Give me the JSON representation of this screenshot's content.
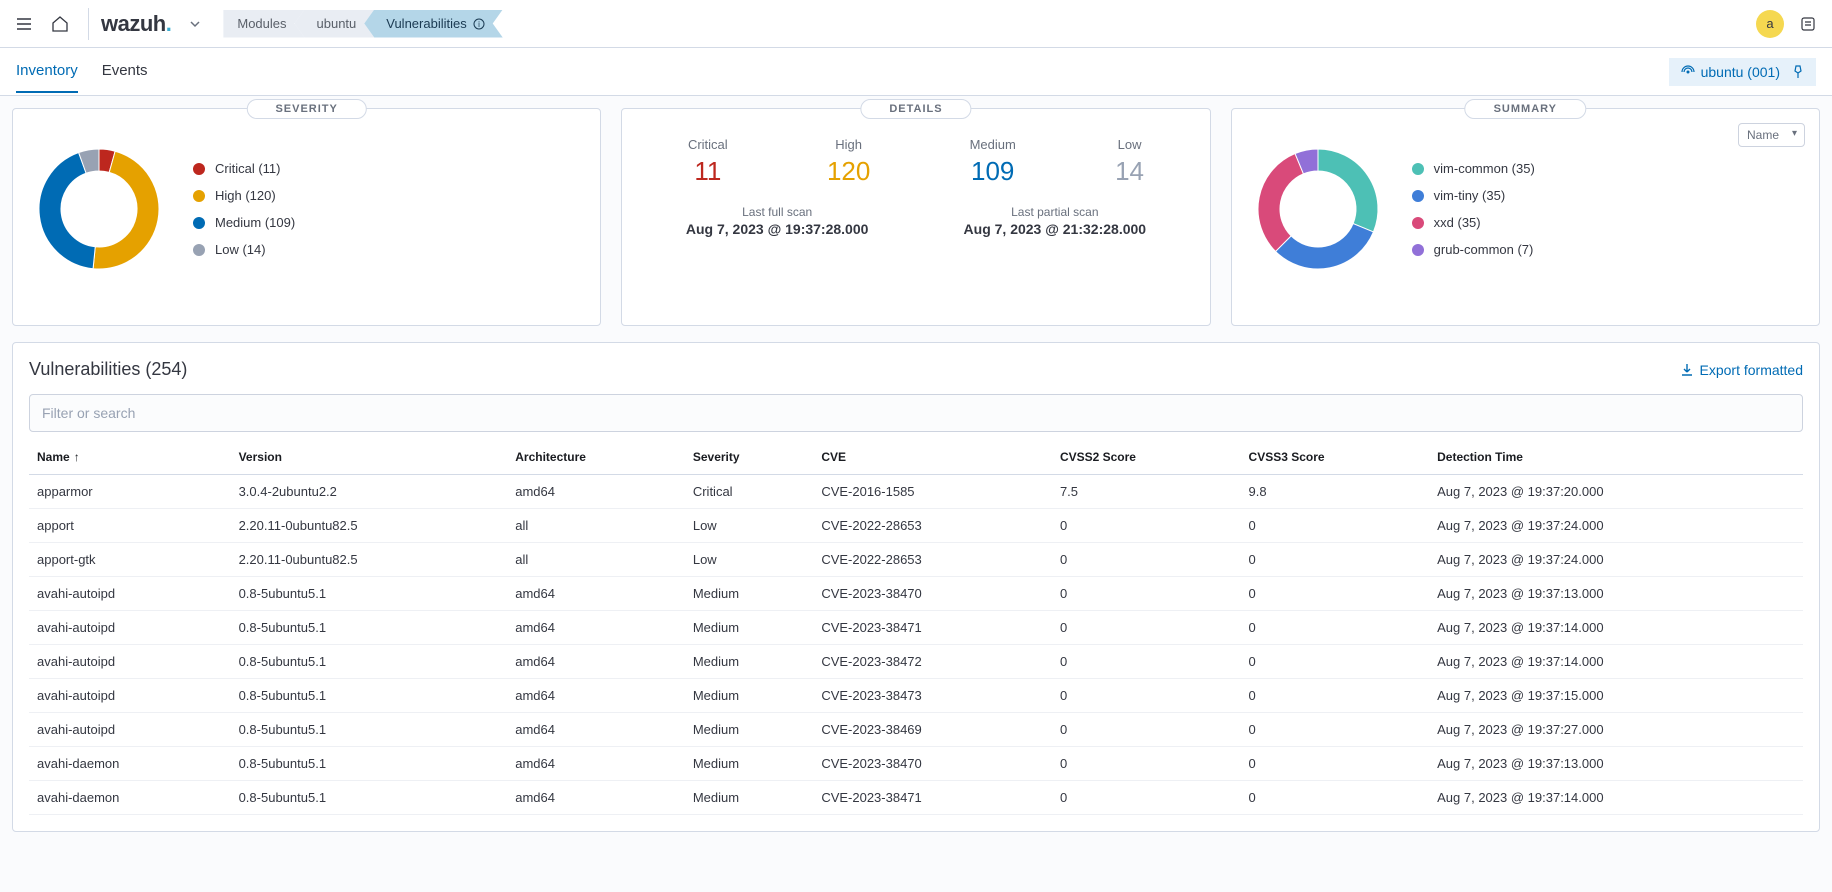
{
  "topbar": {
    "logo": "wazuh",
    "crumbs": [
      "Modules",
      "ubuntu",
      "Vulnerabilities"
    ],
    "avatar": "a"
  },
  "subheader": {
    "tabs": [
      "Inventory",
      "Events"
    ],
    "active_tab": 0,
    "agent_badge": "ubuntu (001)"
  },
  "severity": {
    "title": "SEVERITY",
    "items": [
      {
        "label": "Critical",
        "count": 11,
        "color": "#bd271e"
      },
      {
        "label": "High",
        "count": 120,
        "color": "#e5a100"
      },
      {
        "label": "Medium",
        "count": 109,
        "color": "#006bb4"
      },
      {
        "label": "Low",
        "count": 14,
        "color": "#98a2b3"
      }
    ]
  },
  "details": {
    "title": "DETAILS",
    "stats": [
      {
        "label": "Critical",
        "value": "11",
        "color": "#bd271e"
      },
      {
        "label": "High",
        "value": "120",
        "color": "#e5a100"
      },
      {
        "label": "Medium",
        "value": "109",
        "color": "#006bb4"
      },
      {
        "label": "Low",
        "value": "14",
        "color": "#98a2b3"
      }
    ],
    "scans": [
      {
        "label": "Last full scan",
        "time": "Aug 7, 2023 @ 19:37:28.000"
      },
      {
        "label": "Last partial scan",
        "time": "Aug 7, 2023 @ 21:32:28.000"
      }
    ]
  },
  "summary": {
    "title": "SUMMARY",
    "select_value": "Name",
    "items": [
      {
        "label": "vim-common",
        "count": 35,
        "color": "#4dc0b5"
      },
      {
        "label": "vim-tiny",
        "count": 35,
        "color": "#3f7ed8"
      },
      {
        "label": "xxd",
        "count": 35,
        "color": "#d94a7a"
      },
      {
        "label": "grub-common",
        "count": 7,
        "color": "#9170d8"
      }
    ]
  },
  "vuln": {
    "title": "Vulnerabilities (254)",
    "export_label": "Export formatted",
    "filter_placeholder": "Filter or search",
    "columns": [
      "Name",
      "Version",
      "Architecture",
      "Severity",
      "CVE",
      "CVSS2 Score",
      "CVSS3 Score",
      "Detection Time"
    ],
    "rows": [
      {
        "name": "apparmor",
        "version": "3.0.4-2ubuntu2.2",
        "arch": "amd64",
        "severity": "Critical",
        "cve": "CVE-2016-1585",
        "cvss2": "7.5",
        "cvss3": "9.8",
        "time": "Aug 7, 2023 @ 19:37:20.000"
      },
      {
        "name": "apport",
        "version": "2.20.11-0ubuntu82.5",
        "arch": "all",
        "severity": "Low",
        "cve": "CVE-2022-28653",
        "cvss2": "0",
        "cvss3": "0",
        "time": "Aug 7, 2023 @ 19:37:24.000"
      },
      {
        "name": "apport-gtk",
        "version": "2.20.11-0ubuntu82.5",
        "arch": "all",
        "severity": "Low",
        "cve": "CVE-2022-28653",
        "cvss2": "0",
        "cvss3": "0",
        "time": "Aug 7, 2023 @ 19:37:24.000"
      },
      {
        "name": "avahi-autoipd",
        "version": "0.8-5ubuntu5.1",
        "arch": "amd64",
        "severity": "Medium",
        "cve": "CVE-2023-38470",
        "cvss2": "0",
        "cvss3": "0",
        "time": "Aug 7, 2023 @ 19:37:13.000"
      },
      {
        "name": "avahi-autoipd",
        "version": "0.8-5ubuntu5.1",
        "arch": "amd64",
        "severity": "Medium",
        "cve": "CVE-2023-38471",
        "cvss2": "0",
        "cvss3": "0",
        "time": "Aug 7, 2023 @ 19:37:14.000"
      },
      {
        "name": "avahi-autoipd",
        "version": "0.8-5ubuntu5.1",
        "arch": "amd64",
        "severity": "Medium",
        "cve": "CVE-2023-38472",
        "cvss2": "0",
        "cvss3": "0",
        "time": "Aug 7, 2023 @ 19:37:14.000"
      },
      {
        "name": "avahi-autoipd",
        "version": "0.8-5ubuntu5.1",
        "arch": "amd64",
        "severity": "Medium",
        "cve": "CVE-2023-38473",
        "cvss2": "0",
        "cvss3": "0",
        "time": "Aug 7, 2023 @ 19:37:15.000"
      },
      {
        "name": "avahi-autoipd",
        "version": "0.8-5ubuntu5.1",
        "arch": "amd64",
        "severity": "Medium",
        "cve": "CVE-2023-38469",
        "cvss2": "0",
        "cvss3": "0",
        "time": "Aug 7, 2023 @ 19:37:27.000"
      },
      {
        "name": "avahi-daemon",
        "version": "0.8-5ubuntu5.1",
        "arch": "amd64",
        "severity": "Medium",
        "cve": "CVE-2023-38470",
        "cvss2": "0",
        "cvss3": "0",
        "time": "Aug 7, 2023 @ 19:37:13.000"
      },
      {
        "name": "avahi-daemon",
        "version": "0.8-5ubuntu5.1",
        "arch": "amd64",
        "severity": "Medium",
        "cve": "CVE-2023-38471",
        "cvss2": "0",
        "cvss3": "0",
        "time": "Aug 7, 2023 @ 19:37:14.000"
      }
    ]
  },
  "chart_data": [
    {
      "type": "pie",
      "title": "SEVERITY",
      "series": [
        {
          "name": "Severity",
          "values": [
            11,
            120,
            109,
            14
          ]
        }
      ],
      "categories": [
        "Critical",
        "High",
        "Medium",
        "Low"
      ]
    },
    {
      "type": "pie",
      "title": "SUMMARY",
      "series": [
        {
          "name": "Name",
          "values": [
            35,
            35,
            35,
            7
          ]
        }
      ],
      "categories": [
        "vim-common",
        "vim-tiny",
        "xxd",
        "grub-common"
      ]
    }
  ]
}
